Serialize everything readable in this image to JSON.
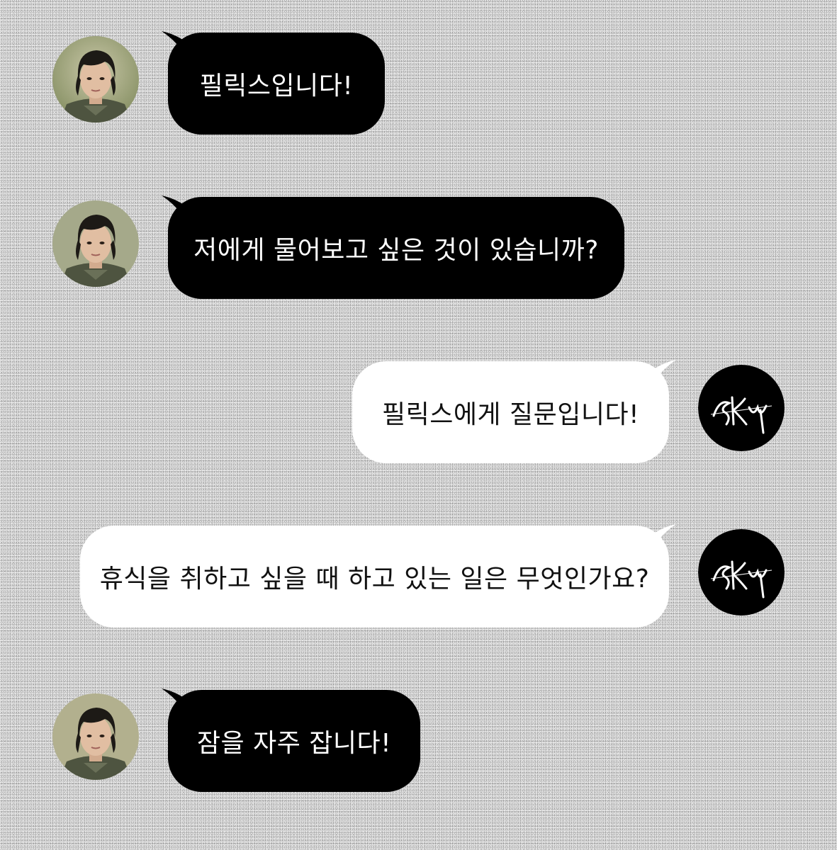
{
  "messages": [
    {
      "sender": "felix",
      "text": "필릭스입니다!"
    },
    {
      "sender": "felix",
      "text": "저에게 물어보고 싶은 것이 있습니까?"
    },
    {
      "sender": "skz",
      "text": "필릭스에게 질문입니다!"
    },
    {
      "sender": "skz",
      "text": "휴식을 취하고 싶을 때 하고 있는 일은 무엇인가요?"
    },
    {
      "sender": "felix",
      "text": "잠을 자주 잡니다!"
    }
  ],
  "colors": {
    "background": "#cfcfcf",
    "incoming_bubble": "#000000",
    "incoming_text": "#ffffff",
    "outgoing_bubble": "#ffffff",
    "outgoing_text": "#111111"
  },
  "icons": {
    "felix_avatar": "felix-profile-photo",
    "skz_avatar": "stray-kids-logo"
  }
}
